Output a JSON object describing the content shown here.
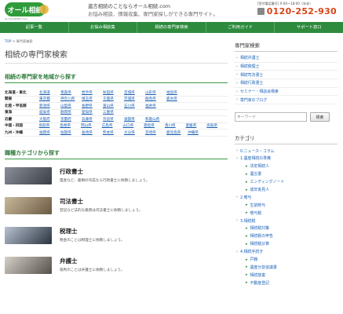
{
  "header": {
    "logo_text": "オール相続",
    "logo_sub": "ALL SOUZOKU.com",
    "tagline_line1": "遺言相続のことならオール相続.com",
    "tagline_line2": "お悩み相談、情報収集、専門家探しができる専門サイト。",
    "phone_hours": "[受付電話番号] 9:00〜18:00（年末）",
    "phone_number": "0120-252-930"
  },
  "nav": {
    "items": [
      "記事一覧",
      "お悩み相談集",
      "相続の専門家検索",
      "ご利用ガイド",
      "サポート窓口"
    ]
  },
  "breadcrumb": {
    "top": "TOP",
    "sep": ">",
    "current": "専門家検索"
  },
  "main": {
    "page_title": "相続の専門家検索",
    "region_section_title": "相続の専門家を地域から探す",
    "regions": [
      {
        "name": "北海道・東北",
        "prefs": [
          "北海道",
          "青森県",
          "岩手県",
          "秋田県",
          "宮城県",
          "山形県",
          "福島県"
        ]
      },
      {
        "name": "関東",
        "prefs": [
          "東京都",
          "神奈川県",
          "埼玉県",
          "千葉県",
          "茨城県",
          "群馬県",
          "栃木県"
        ]
      },
      {
        "name": "北陸・甲信越",
        "prefs": [
          "新潟県",
          "山梨県",
          "長野県",
          "富山県",
          "石川県",
          "福井県"
        ]
      },
      {
        "name": "東海",
        "prefs": [
          "岐阜県",
          "静岡県",
          "愛知県",
          "三重県"
        ]
      },
      {
        "name": "近畿",
        "prefs": [
          "大阪府",
          "京都府",
          "兵庫県",
          "奈良県",
          "滋賀県",
          "和歌山県"
        ]
      },
      {
        "name": "中国・四国",
        "prefs": [
          "鳥取県",
          "島根県",
          "岡山県",
          "広島県",
          "山口県",
          "徳島県",
          "香川県",
          "愛媛県",
          "高知県"
        ]
      },
      {
        "name": "九州・沖縄",
        "prefs": [
          "福岡県",
          "佐賀県",
          "長崎県",
          "熊本県",
          "大分県",
          "宮崎県",
          "鹿児島県",
          "沖縄県"
        ]
      }
    ],
    "category_section_title": "職種カテゴリから探す",
    "categories": [
      {
        "name": "行政書士",
        "desc": "遺産など、書類の作成なら行政書士に依頼しましょう。"
      },
      {
        "name": "司法書士",
        "desc": "登記など法的な業務は司法書士に依頼しましょう。"
      },
      {
        "name": "税理士",
        "desc": "税金のことは税理士に依頼しましょう。"
      },
      {
        "name": "弁護士",
        "desc": "裁判のことは弁護士に依頼しましょう。"
      }
    ]
  },
  "sidebar": {
    "search_title": "専門家検索",
    "search_links": [
      "相続弁護士",
      "相続税理士",
      "相続司法書士",
      "相続行政書士",
      "セミナー・相談会検索",
      "専門家のブログ"
    ],
    "search_placeholder": "キーワード",
    "search_button": "検索",
    "category_title": "カテゴリ",
    "categories": [
      {
        "label": "0.ニュース・コラム",
        "level": 0
      },
      {
        "label": "1.遺産相続の準備",
        "level": 0
      },
      {
        "label": "法定相続人",
        "level": 1
      },
      {
        "label": "遺言書",
        "level": 1
      },
      {
        "label": "エンディングノート",
        "level": 1
      },
      {
        "label": "成年後見人",
        "level": 1
      },
      {
        "label": "2.贈与",
        "level": 0
      },
      {
        "label": "生前贈与",
        "level": 1
      },
      {
        "label": "贈与税",
        "level": 1
      },
      {
        "label": "3.相続税",
        "level": 0
      },
      {
        "label": "相続税対策",
        "level": 1
      },
      {
        "label": "相続税の申告",
        "level": 1
      },
      {
        "label": "相続税計算",
        "level": 1
      },
      {
        "label": "4.相続手続き",
        "level": 0
      },
      {
        "label": "戸籍",
        "level": 1
      },
      {
        "label": "遺産分割協議書",
        "level": 1
      },
      {
        "label": "相続放棄",
        "level": 1
      },
      {
        "label": "不動産登記",
        "level": 1
      }
    ]
  },
  "colors": {
    "brand_green": "#2e8b3e",
    "phone_orange": "#d64518",
    "link_blue": "#1a5fb4"
  }
}
